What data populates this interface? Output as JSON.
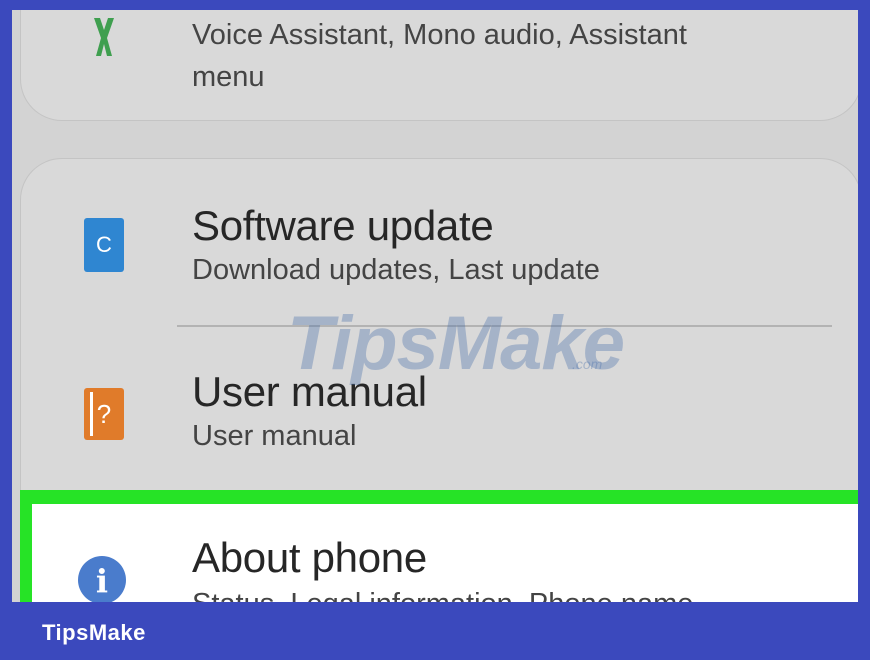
{
  "settings": {
    "accessibility": {
      "subtitle": "Voice Assistant, Mono audio, Assistant menu",
      "icon": "accessibility-icon",
      "icon_color": "#3f9f4f"
    },
    "software_update": {
      "title": "Software update",
      "subtitle": "Download updates, Last update",
      "icon": "software-update-icon",
      "icon_glyph": "C",
      "icon_color": "#2f86d1"
    },
    "user_manual": {
      "title": "User manual",
      "subtitle": "User manual",
      "icon": "user-manual-icon",
      "icon_glyph": "?",
      "icon_color": "#e07b2a"
    },
    "about_phone": {
      "title": "About phone",
      "subtitle": "Status, Legal information, Phone name",
      "icon": "info-icon",
      "icon_glyph": "i",
      "icon_color": "#4a7ccc",
      "highlight_color": "#26e326"
    }
  },
  "watermark": {
    "text": "TipsMake",
    "suffix": ".com"
  },
  "footer": {
    "brand": "TipsMake",
    "background": "#3b49bd"
  }
}
